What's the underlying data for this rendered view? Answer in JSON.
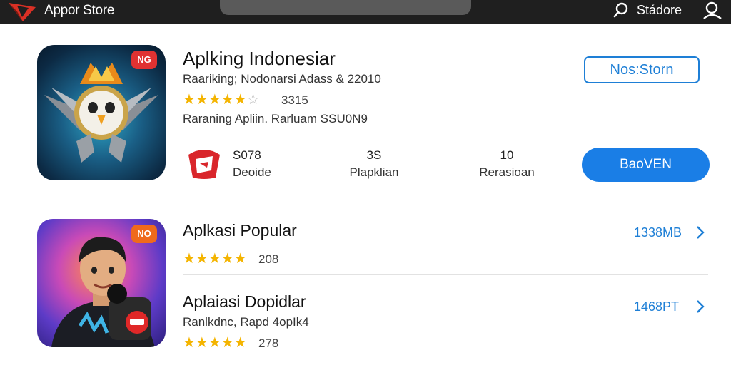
{
  "topbar": {
    "app_title": "Appor Store",
    "store_label": "Stádore"
  },
  "featured": {
    "badge": "NG",
    "title": "Aplking Indonesiar",
    "subtitle": "Raariking; Nodonarsi Adass & 22010",
    "rating_count": "3315",
    "description": "Raraning Apliin. Rarluam SSU0N9",
    "outline_button": "Nos:Storn",
    "stats": [
      {
        "value": "S078",
        "label": "Deoide"
      },
      {
        "value": "3S",
        "label": "Plapklian"
      },
      {
        "value": "10",
        "label": "Rerasioan"
      }
    ],
    "primary_button": "BaoVEN"
  },
  "popular": {
    "badge": "NO",
    "items": [
      {
        "title": "Aplkasi Popular",
        "subtitle": "",
        "rating_count": "208",
        "size": "1338MB"
      },
      {
        "title": "Aplaiasi Dopidlar",
        "subtitle": "Ranlkdnc, Rapd 4opIk4",
        "rating_count": "278",
        "size": "1468PT"
      }
    ]
  },
  "colors": {
    "topbar": "#1f1f1f",
    "accent": "#1a7ee6",
    "star": "#f4b400"
  }
}
